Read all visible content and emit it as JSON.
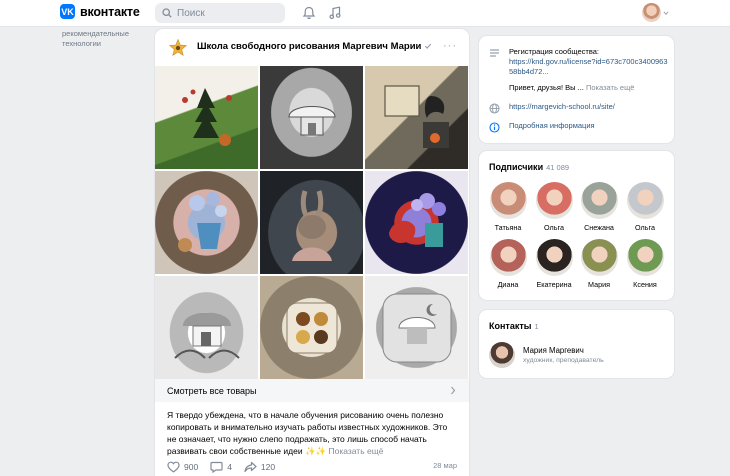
{
  "header": {
    "logo_text": "вконтакте",
    "logo_mark": "VK",
    "search_placeholder": "Поиск"
  },
  "left_nav": {
    "text": "рекомендательные технологии"
  },
  "post": {
    "community_name": "Школа свободного рисования Маргевич Марии",
    "more_label": "···",
    "goods_label": "Смотреть все товары",
    "text": "Я твердо убеждена, что в начале обучения рисованию очень полезно копировать и внимательно изучать работы известных художников. Это не означает, что нужно слепо подражать, это лишь способ начать развивать свои собственные идеи ✨✨",
    "show_more": "Показать ещё",
    "likes": "900",
    "comments": "4",
    "shares": "120",
    "date": "28 мар"
  },
  "info": {
    "registration_label": "Регистрация сообщества:",
    "registration_link": "https://knd.gov.ru/license?id=673c700c340096358bb4d72...",
    "greeting": "Привет, друзья! Вы ...",
    "greeting_more": "Показать ещё",
    "site": "https://margevich-school.ru/site/",
    "details": "Подробная информация"
  },
  "subscribers": {
    "title": "Подписчики",
    "count": "41 089",
    "people": [
      {
        "name": "Татьяна",
        "color": "#c98d77"
      },
      {
        "name": "Ольга",
        "color": "#d86d63"
      },
      {
        "name": "Снежана",
        "color": "#9aa39a"
      },
      {
        "name": "Ольга",
        "color": "#c4c8cc"
      },
      {
        "name": "Диана",
        "color": "#b5635a"
      },
      {
        "name": "Екатерина",
        "color": "#2a2320"
      },
      {
        "name": "Мария",
        "color": "#8a8f52"
      },
      {
        "name": "Ксения",
        "color": "#6f9a54"
      }
    ]
  },
  "contacts": {
    "title": "Контакты",
    "count": "1",
    "name": "Мария Маргевич",
    "role": "художник, преподаватель"
  },
  "colors": {
    "accent": "#0077ff",
    "link": "#2a5885",
    "muted": "#818c99"
  }
}
